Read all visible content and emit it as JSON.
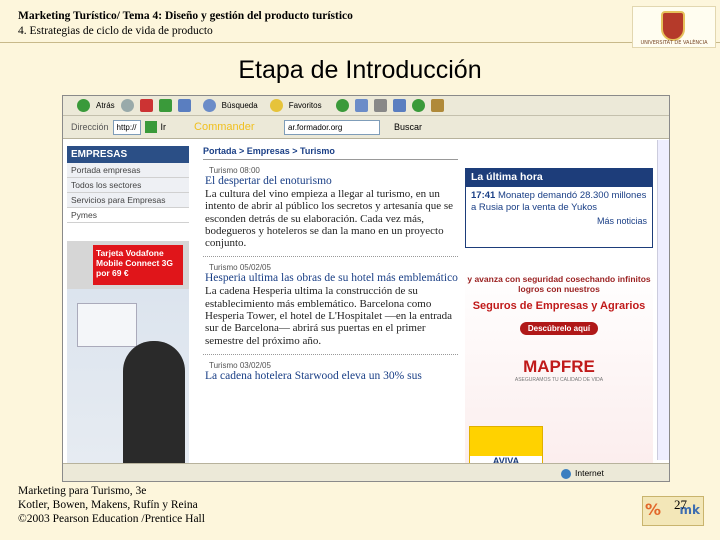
{
  "header": {
    "course_line": "Marketing Turístico/ Tema 4: Diseño y gestión del producto turístico",
    "section_line": "4. Estrategias de ciclo de vida de producto",
    "logo_text": "UNIVERSITAT DE VALÈNCIA"
  },
  "slide_title": "Etapa de Introducción",
  "browser": {
    "toolbar": {
      "back": "Atrás",
      "search": "Búsqueda",
      "favorites": "Favoritos"
    },
    "address_label": "Dirección",
    "address_value": "http://",
    "go_label": "Ir",
    "commander": "Commander",
    "search_field": "ar.formador.org",
    "search_button": "Buscar",
    "status_zone": "Internet"
  },
  "page": {
    "sidebar_title": "EMPRESAS",
    "sidebar_items": [
      "Portada empresas",
      "Todos los sectores",
      "Servicios para Empresas",
      "Pymes"
    ],
    "vodafone_ad": "Tarjeta Vodafone Mobile Connect 3G por 69 €",
    "breadcrumb": "Portada > Empresas > Turismo",
    "articles": [
      {
        "time": "Turismo 08:00",
        "title": "El despertar del enoturismo",
        "body": "La cultura del vino empieza a llegar al turismo, en un intento de abrir al público los secretos y artesanía que se esconden detrás de su elaboración. Cada vez más, bodegueros y hoteleros se dan la mano en un proyecto conjunto."
      },
      {
        "time": "Turismo 05/02/05",
        "title": "Hesperia ultima las obras de su hotel más emblemático",
        "body": "La cadena Hesperia ultima la construcción de su establecimiento más emblemático. Barcelona como Hesperia Tower, el hotel de L'Hospitalet —en la entrada sur de Barcelona— abrirá sus puertas en el primer semestre del próximo año."
      },
      {
        "time": "Turismo 03/02/05",
        "title": "La cadena hotelera Starwood eleva un 30% sus",
        "body": ""
      }
    ],
    "latest": {
      "title": "La última hora",
      "time": "17:41",
      "text": "Monatep demandó 28.300 millones a Rusia por la venta de Yukos",
      "more": "Más noticias"
    },
    "mapfre_ad": {
      "line1": "y avanza con seguridad cosechando infinitos logros con nuestros",
      "line2": "Seguros de Empresas y Agrarios",
      "button": "Descúbrelo aquí",
      "brand": "MAPFRE",
      "tagline": "ASEGURAMOS TU CALIDAD DE VIDA"
    },
    "aviva": "AVIVA"
  },
  "footer": {
    "line1": "Marketing para Turismo, 3e",
    "line2": "Kotler, Bowen, Makens, Rufín y Reina",
    "line3": "©2003 Pearson Education /Prentice Hall",
    "page_number": "27",
    "mk_logo": "mk"
  }
}
